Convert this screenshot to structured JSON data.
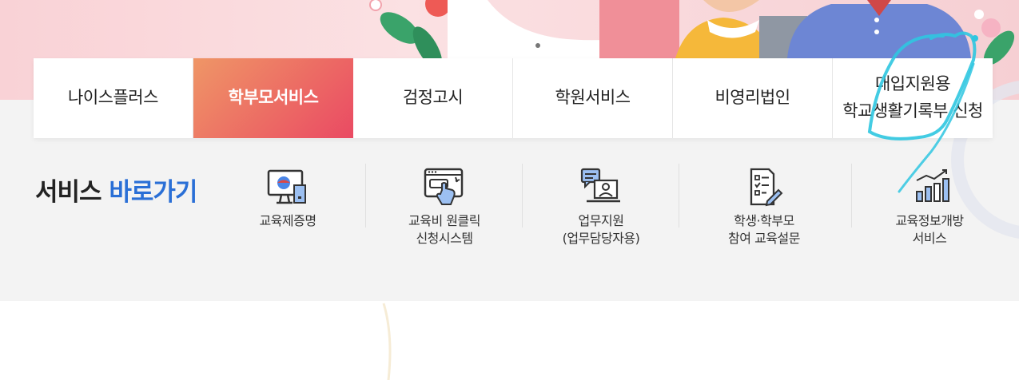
{
  "nav": {
    "tabs": [
      {
        "label": "나이스플러스",
        "active": false
      },
      {
        "label": "학부모서비스",
        "active": true
      },
      {
        "label": "검정고시",
        "active": false
      },
      {
        "label": "학원서비스",
        "active": false
      },
      {
        "label": "비영리법인",
        "active": false
      },
      {
        "label": "대입지원용\n학교생활기록부 신청",
        "active": false
      }
    ]
  },
  "shortcuts": {
    "title_main": "서비스",
    "title_accent": "바로가기",
    "items": [
      {
        "label": "교육제증명",
        "icon": "certificate-monitor-icon"
      },
      {
        "label": "교육비 원클릭\n신청시스템",
        "icon": "one-click-hand-icon"
      },
      {
        "label": "업무지원\n(업무담당자용)",
        "icon": "staff-chat-icon"
      },
      {
        "label": "학생·학부모\n참여 교육설문",
        "icon": "survey-checklist-icon"
      },
      {
        "label": "교육정보개방\n서비스",
        "icon": "bar-chart-icon"
      }
    ]
  },
  "colors": {
    "accent_blue": "#2a6fd6",
    "active_start": "#ef9666",
    "active_end": "#ea4a63",
    "annotation": "#2fc6e0"
  }
}
